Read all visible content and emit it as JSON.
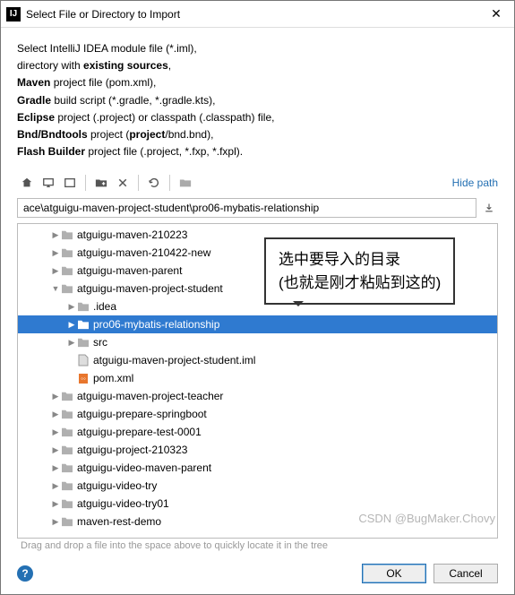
{
  "titlebar": {
    "title": "Select File or Directory to Import"
  },
  "instructions": {
    "l1a": "Select IntelliJ IDEA module file (*.iml),",
    "l2a": "directory with ",
    "l2b": "existing sources",
    "l2c": ",",
    "l3a": "Maven",
    "l3b": " project file (pom.xml),",
    "l4a": "Gradle",
    "l4b": " build script (*.gradle, *.gradle.kts),",
    "l5a": "Eclipse",
    "l5b": " project (.project) or classpath (.classpath) file,",
    "l6a": "Bnd/Bndtools",
    "l6b": " project (",
    "l6c": "project",
    "l6d": "/bnd.bnd),",
    "l7a": "Flash Builder",
    "l7b": " project file (.project, *.fxp, *.fxpl)."
  },
  "toolbar": {
    "hide_path": "Hide path"
  },
  "path": {
    "value": "ace\\atguigu-maven-project-student\\pro06-mybatis-relationship"
  },
  "tree": [
    {
      "indent": 2,
      "arrow": ">",
      "type": "folder",
      "label": "atguigu-maven-210223"
    },
    {
      "indent": 2,
      "arrow": ">",
      "type": "folder",
      "label": "atguigu-maven-210422-new"
    },
    {
      "indent": 2,
      "arrow": ">",
      "type": "folder",
      "label": "atguigu-maven-parent"
    },
    {
      "indent": 2,
      "arrow": "v",
      "type": "folder",
      "label": "atguigu-maven-project-student"
    },
    {
      "indent": 3,
      "arrow": ">",
      "type": "folder",
      "label": ".idea"
    },
    {
      "indent": 3,
      "arrow": ">",
      "type": "folder-sel",
      "label": "pro06-mybatis-relationship",
      "selected": true
    },
    {
      "indent": 3,
      "arrow": ">",
      "type": "folder",
      "label": "src"
    },
    {
      "indent": 3,
      "arrow": "",
      "type": "iml",
      "label": "atguigu-maven-project-student.iml"
    },
    {
      "indent": 3,
      "arrow": "",
      "type": "xml",
      "label": "pom.xml"
    },
    {
      "indent": 2,
      "arrow": ">",
      "type": "folder",
      "label": "atguigu-maven-project-teacher"
    },
    {
      "indent": 2,
      "arrow": ">",
      "type": "folder",
      "label": "atguigu-prepare-springboot"
    },
    {
      "indent": 2,
      "arrow": ">",
      "type": "folder",
      "label": "atguigu-prepare-test-0001"
    },
    {
      "indent": 2,
      "arrow": ">",
      "type": "folder",
      "label": "atguigu-project-210323"
    },
    {
      "indent": 2,
      "arrow": ">",
      "type": "folder",
      "label": "atguigu-video-maven-parent"
    },
    {
      "indent": 2,
      "arrow": ">",
      "type": "folder",
      "label": "atguigu-video-try"
    },
    {
      "indent": 2,
      "arrow": ">",
      "type": "folder",
      "label": "atguigu-video-try01"
    },
    {
      "indent": 2,
      "arrow": ">",
      "type": "folder",
      "label": "maven-rest-demo"
    }
  ],
  "hint": "Drag and drop a file into the space above to quickly locate it in the tree",
  "buttons": {
    "ok": "OK",
    "cancel": "Cancel"
  },
  "annotation": {
    "l1": "选中要导入的目录",
    "l2": "(也就是刚才粘贴到这的)"
  },
  "watermark": "CSDN @BugMaker.Chovy"
}
